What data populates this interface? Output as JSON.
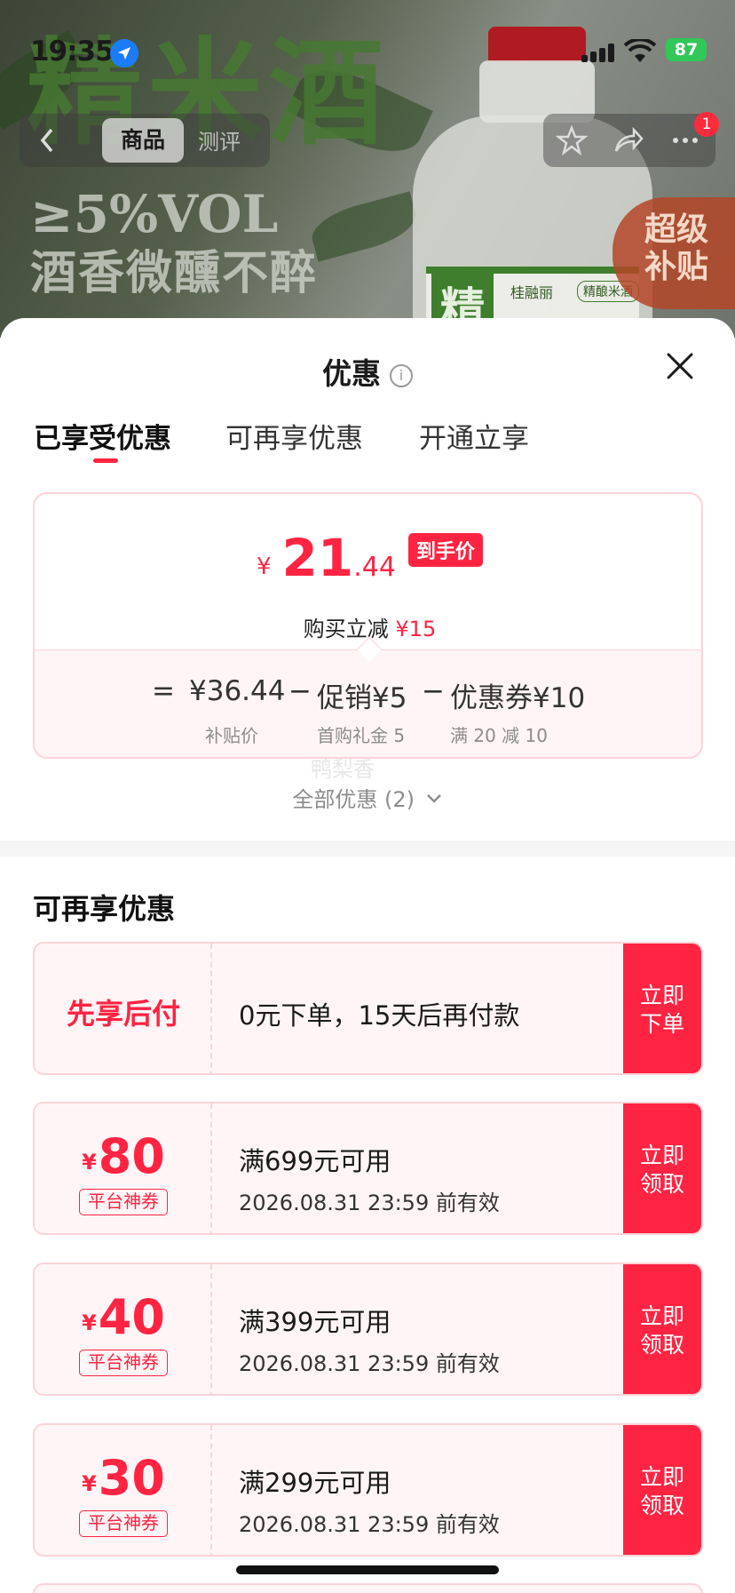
{
  "status_bar": {
    "time": "19:35",
    "battery": "87"
  },
  "hero": {
    "title": "精米酒",
    "abv": "≥5%VOL",
    "slogan": "酒香微醺不醉",
    "badge_line1": "超级",
    "badge_line2": "补贴"
  },
  "nav": {
    "tab_product": "商品",
    "tab_review": "测评",
    "notification_count": "1"
  },
  "sheet": {
    "title": "优惠",
    "tabs": [
      "已享受优惠",
      "可再享优惠",
      "开通立享"
    ],
    "price_card": {
      "currency": "¥",
      "price_integer": "21",
      "price_decimal": ".44",
      "price_tag": "到手价",
      "save_label": "购买立减",
      "save_amount": "¥15",
      "formula": {
        "equals": "=",
        "base": "¥36.44",
        "base_label": "补贴价",
        "minus1": "−",
        "promo": "促销¥5",
        "promo_label": "首购礼金 5",
        "minus2": "−",
        "coupon": "优惠券¥10",
        "coupon_label": "满 20 减 10"
      }
    },
    "all_promotions": "全部优惠 (2)",
    "watermark": "鸭梨香",
    "section_title": "可再享优惠",
    "pay_later": {
      "label": "先享后付",
      "desc": "0元下单，15天后再付款",
      "button_line1": "立即",
      "button_line2": "下单"
    },
    "coupons": [
      {
        "currency": "¥",
        "amount": "80",
        "tag": "平台神券",
        "condition": "满699元可用",
        "validity": "2026.08.31 23:59 前有效",
        "button_line1": "立即",
        "button_line2": "领取"
      },
      {
        "currency": "¥",
        "amount": "40",
        "tag": "平台神券",
        "condition": "满399元可用",
        "validity": "2026.08.31 23:59 前有效",
        "button_line1": "立即",
        "button_line2": "领取"
      },
      {
        "currency": "¥",
        "amount": "30",
        "tag": "平台神券",
        "condition": "满299元可用",
        "validity": "2026.08.31 23:59 前有效",
        "button_line1": "立即",
        "button_line2": "领取"
      }
    ]
  },
  "colors": {
    "accent": "#ff2442",
    "card_bg": "#fff5f6",
    "card_border": "#fbd3d8"
  }
}
